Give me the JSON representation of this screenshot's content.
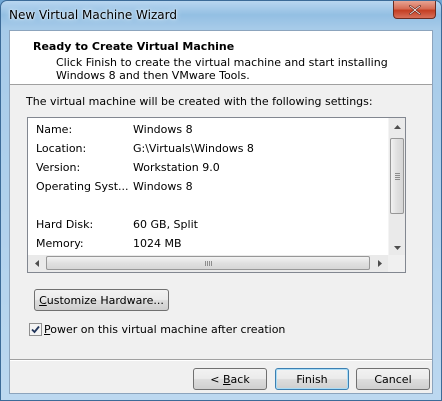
{
  "window": {
    "title": "New Virtual Machine Wizard"
  },
  "header": {
    "title": "Ready to Create Virtual Machine",
    "description": "Click Finish to create the virtual machine and start installing Windows 8 and then VMware Tools."
  },
  "settings_label": "The virtual machine will be created with the following settings:",
  "settings": [
    {
      "key": "Name:",
      "value": "Windows 8"
    },
    {
      "key": "Location:",
      "value": "G:\\Virtuals\\Windows 8"
    },
    {
      "key": "Version:",
      "value": "Workstation 9.0"
    },
    {
      "key": "Operating Syst...",
      "value": "Windows 8"
    },
    {
      "key": "",
      "value": ""
    },
    {
      "key": "Hard Disk:",
      "value": "60 GB, Split"
    },
    {
      "key": "Memory:",
      "value": "1024 MB"
    }
  ],
  "customize_button": {
    "prefix": "",
    "accel": "C",
    "suffix": "ustomize Hardware..."
  },
  "power_on": {
    "checked": true,
    "accel": "P",
    "label_rest": "ower on this virtual machine after creation"
  },
  "buttons": {
    "back": {
      "prefix": "< ",
      "accel": "B",
      "suffix": "ack"
    },
    "finish": "Finish",
    "cancel": "Cancel"
  },
  "icons": {
    "close": "close-icon",
    "scroll_up": "scroll-up-arrow-icon",
    "scroll_down": "scroll-down-arrow-icon",
    "scroll_left": "scroll-left-arrow-icon",
    "scroll_right": "scroll-right-arrow-icon",
    "check": "checkmark-icon"
  }
}
